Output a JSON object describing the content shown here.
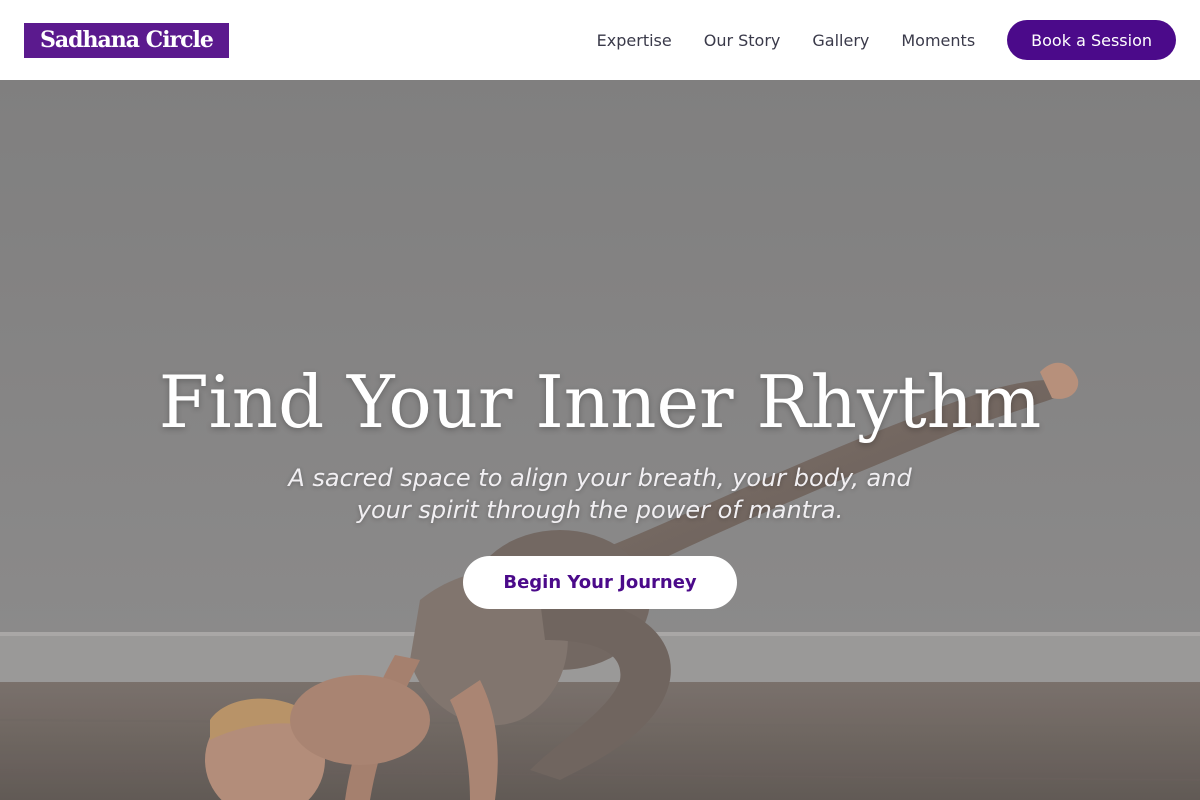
{
  "brand": {
    "logo_text": "Sadhana Circle",
    "accent": "#4b0a8a",
    "logo_bg": "#5b1a8e"
  },
  "nav": {
    "links": [
      {
        "label": "Expertise"
      },
      {
        "label": "Our Story"
      },
      {
        "label": "Gallery"
      },
      {
        "label": "Moments"
      }
    ],
    "cta_label": "Book a Session"
  },
  "hero": {
    "title": "Find Your Inner Rhythm",
    "subtitle": "A sacred space to align your breath, your body, and your spirit through the power of mantra.",
    "cta_label": "Begin Your Journey",
    "image_subject": "woman in taupe activewear doing an arm-balance yoga pose on a wooden floor"
  }
}
